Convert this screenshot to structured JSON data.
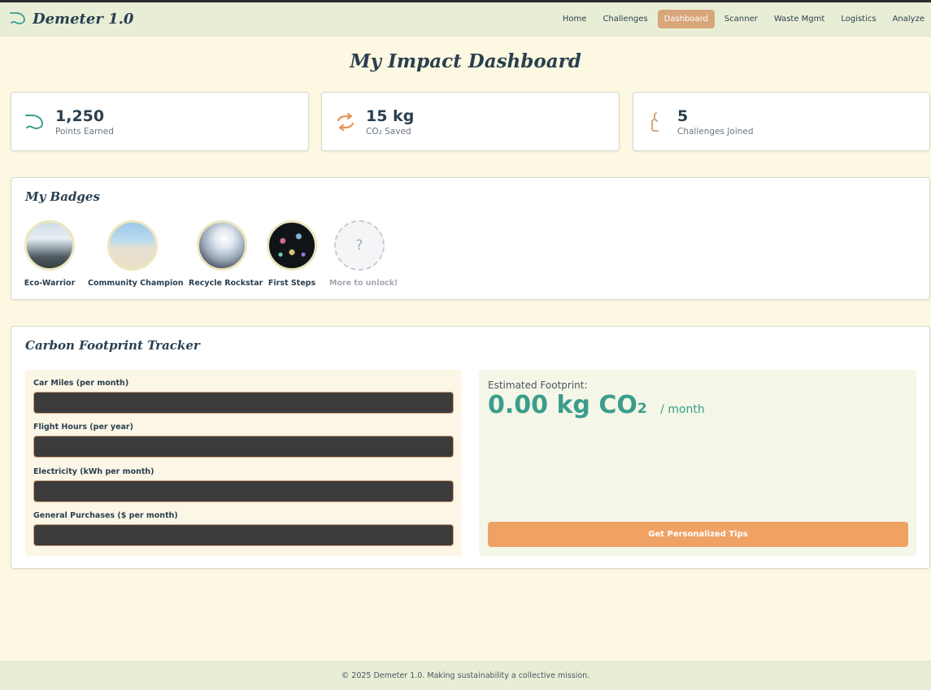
{
  "brand": {
    "name": "Demeter 1.0",
    "logo_icon": "leaf-logo-icon"
  },
  "nav": {
    "items": [
      {
        "label": "Home",
        "active": false
      },
      {
        "label": "Challenges",
        "active": false
      },
      {
        "label": "Dashboard",
        "active": true
      },
      {
        "label": "Scanner",
        "active": false
      },
      {
        "label": "Waste Mgmt",
        "active": false
      },
      {
        "label": "Logistics",
        "active": false
      },
      {
        "label": "Analyze",
        "active": false
      }
    ]
  },
  "page": {
    "title": "My Impact Dashboard"
  },
  "stats": [
    {
      "value": "1,250",
      "label": "Points Earned",
      "icon": "leaf-icon",
      "color": "#3a9d8c"
    },
    {
      "value": "15 kg",
      "label": "CO₂ Saved",
      "icon": "recycle-arrows-icon",
      "color": "#e8955a"
    },
    {
      "value": "5",
      "label": "Challenges Joined",
      "icon": "hand-icon",
      "color": "#d8a67b"
    }
  ],
  "badges": {
    "title": "My Badges",
    "items": [
      {
        "label": "Eco-Warrior",
        "icon": "coastline-photo"
      },
      {
        "label": "Community Champion",
        "icon": "beach-photo"
      },
      {
        "label": "Recycle Rockstar",
        "icon": "concert-lights-photo"
      },
      {
        "label": "First Steps",
        "icon": "sparkles-photo"
      }
    ],
    "locked": {
      "symbol": "?",
      "label": "More to unlock!"
    }
  },
  "tracker": {
    "title": "Carbon Footprint Tracker",
    "fields": [
      {
        "label": "Car Miles (per month)",
        "value": ""
      },
      {
        "label": "Flight Hours (per year)",
        "value": ""
      },
      {
        "label": "Electricity (kWh per month)",
        "value": ""
      },
      {
        "label": "General Purchases ($ per month)",
        "value": ""
      }
    ],
    "result": {
      "label": "Estimated Footprint:",
      "value": "0.00 kg",
      "unit": "CO",
      "unit_sub": "2",
      "period": "/ month"
    },
    "tips_button": "Get Personalized Tips"
  },
  "footer": {
    "text": "© 2025 Demeter 1.0. Making sustainability a collective mission."
  },
  "colors": {
    "accent": "#3a9d8c",
    "orange": "#f0a265",
    "nav_active": "#d8a67b",
    "background": "#fdf8e1"
  }
}
